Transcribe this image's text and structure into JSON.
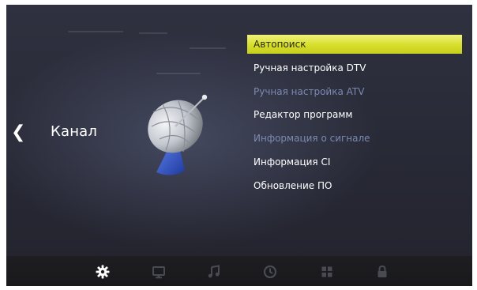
{
  "section": {
    "title": "Канал",
    "back_icon": "chevron-left-icon",
    "illustration": "satellite-dish-icon"
  },
  "menu": {
    "items": [
      {
        "label": "Автопоиск",
        "state": "selected"
      },
      {
        "label": "Ручная настройка DTV",
        "state": "normal"
      },
      {
        "label": "Ручная настройка ATV",
        "state": "disabled"
      },
      {
        "label": "Редактор программ",
        "state": "normal"
      },
      {
        "label": "Информация о сигнале",
        "state": "disabled"
      },
      {
        "label": "Информация CI",
        "state": "normal"
      },
      {
        "label": "Обновление ПО",
        "state": "normal"
      }
    ]
  },
  "bottom_nav": {
    "items": [
      {
        "icon": "gear-icon",
        "active": true
      },
      {
        "icon": "monitor-icon",
        "active": false
      },
      {
        "icon": "music-note-icon",
        "active": false
      },
      {
        "icon": "clock-icon",
        "active": false
      },
      {
        "icon": "grid-icon",
        "active": false
      },
      {
        "icon": "lock-icon",
        "active": false
      }
    ]
  },
  "colors": {
    "selection": "#d7de2b",
    "disabled_text": "#7b8ab2",
    "background": "#2a2c39",
    "bottom_bar": "#1b1b1e"
  }
}
